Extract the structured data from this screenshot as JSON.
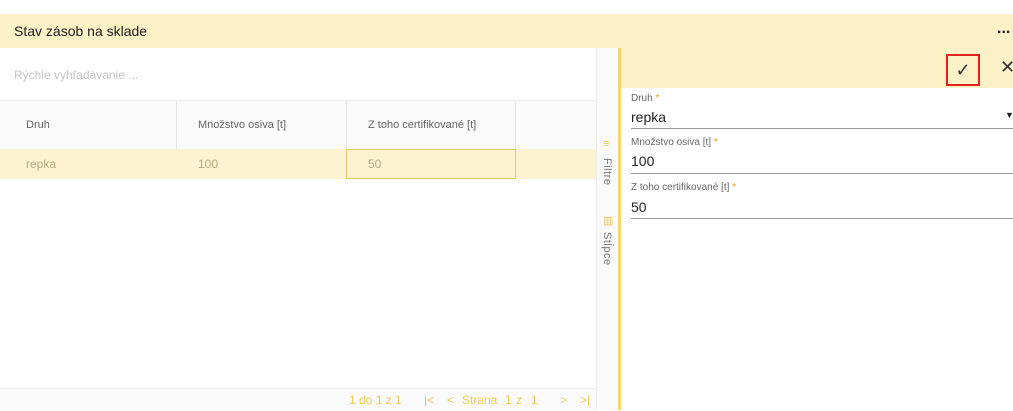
{
  "header": {
    "title": "Stav zásob na sklade",
    "more_icon": "..."
  },
  "grid": {
    "search_placeholder": "Rýchle vyhľadávanie ...",
    "columns": [
      "Druh",
      "Množstvo osiva [t]",
      "Z toho certifikované [t]"
    ],
    "rows": [
      {
        "druh": "repka",
        "mnozstvo": "100",
        "certifikovane": "50"
      }
    ],
    "pagination": {
      "range": "1 do 1 z 1",
      "first": "|<",
      "prev": "<",
      "page_label": "Strana",
      "page": "1",
      "of": "z",
      "total": "1",
      "next": ">",
      "last": ">|"
    }
  },
  "side_panel": {
    "filters_label": "Filtre",
    "columns_label": "Stĺpce"
  },
  "form": {
    "confirm_icon": "✓",
    "close_icon": "✕",
    "fields": [
      {
        "label": "Druh",
        "required": "*",
        "value": "repka"
      },
      {
        "label": "Množstvo osiva [t]",
        "required": "*",
        "value": "100"
      },
      {
        "label": "Z toho certifikované [t]",
        "required": "*",
        "value": "50"
      }
    ]
  },
  "colors": {
    "accent": "#fdf1c7",
    "highlight_row": "#fdf3d3",
    "confirm_border": "#e0231f"
  }
}
